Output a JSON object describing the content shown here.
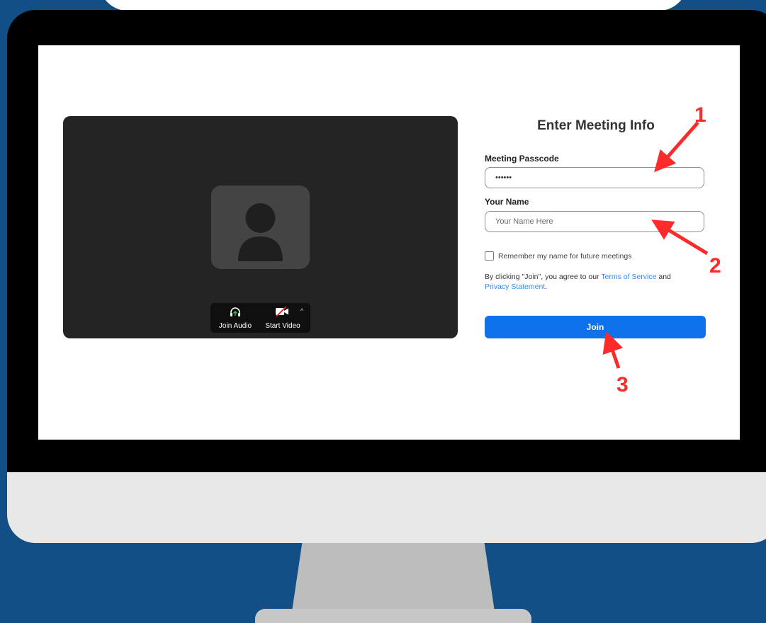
{
  "preview": {
    "join_audio_label": "Join Audio",
    "start_video_label": "Start Video",
    "caret": "^"
  },
  "form": {
    "title": "Enter Meeting Info",
    "passcode_label": "Meeting Passcode",
    "passcode_value": "••••••",
    "name_label": "Your Name",
    "name_placeholder": "Your Name Here",
    "remember_label": "Remember my name for future meetings",
    "terms_prefix": "By clicking \"Join\", you agree to our ",
    "terms_link": "Terms of Service",
    "terms_and": " and",
    "privacy_link": "Privacy Statement",
    "terms_end": ".",
    "join_label": "Join"
  },
  "annotations": {
    "step1": "1",
    "step2": "2",
    "step3": "3",
    "color": "#ff2b2b"
  },
  "colors": {
    "background": "#124f86",
    "join_button": "#0e72ed",
    "link": "#2d8cff"
  }
}
